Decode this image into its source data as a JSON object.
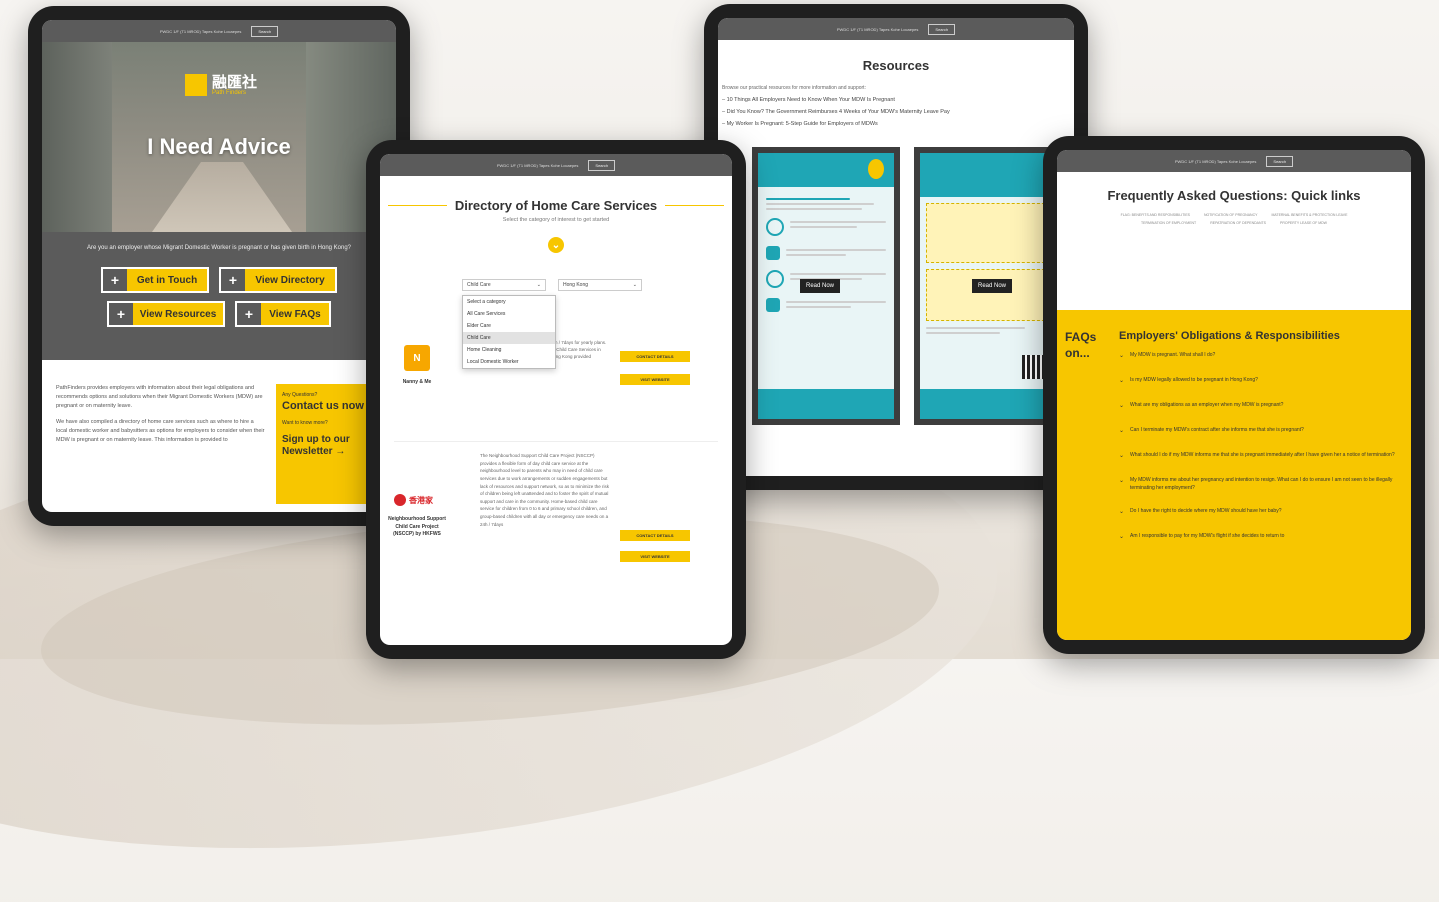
{
  "topbar": {
    "text": "PWDC 1/F (T1 MROD) Tapes Kohe Locaepes",
    "button": "Search"
  },
  "advice": {
    "logo_text": "融匯社",
    "logo_sub": "Path Finders",
    "hero_title": "I Need Advice",
    "question": "Are you an employer whose Migrant Domestic Worker is pregnant or has given birth in Hong Kong?",
    "buttons": [
      "Get in Touch",
      "View Directory",
      "View Resources",
      "View FAQs"
    ],
    "body_paragraphs": [
      "PathFinders provides employers with information about their legal obligations and recommends options and solutions when their Migrant Domestic Workers (MDW) are pregnant or on maternity leave.",
      "We have also compiled a directory of home care services such as where to hire a local domestic worker and babysitters as options for employers to consider when their MDW is pregnant or on maternity leave. This information is provided to"
    ],
    "side_box": {
      "small1": "Any Questions?",
      "contact": "Contact us now",
      "small2": "Want to know more?",
      "newsletter": "Sign up to our Newsletter →"
    }
  },
  "directory": {
    "title": "Directory of Home Care Services",
    "subtitle": "Select the category of interest to get started",
    "select_category": "Child Care",
    "select_region": "Hong Kong",
    "dropdown_options": [
      "Select a category",
      "All Care Services",
      "Elder Care",
      "Child Care",
      "Home Cleaning",
      "Local Domestic Worker"
    ],
    "provider1": {
      "name": "Nanny & Me",
      "desc": "24h / 7days for yearly plans. All Child Care Services in Hong Kong provided"
    },
    "provider2": {
      "logo_text": "香港家",
      "name": "Neighbourhood Support Child Care Project (NSCCP) by HKFWS",
      "desc": "The Neighbourhood Support Child Care Project (NSCCP) provides a flexible form of day child care service at the neighbourhood level to parents who may in need of child care services due to work arrangements or sudden engagements but lack of resources and support network, so as to minimize the risk of children being left unattended and to foster the spirit of mutual support and care in the community. Home-based child care service for children from 0 to 6 and primary school children, and group-based children with all day or emergency care needs on a 24h / 7days"
    },
    "contact_label": "CONTACT DETAILS",
    "website_label": "VISIT WEBSITE"
  },
  "resources": {
    "title": "Resources",
    "intro": "Browse our practical resources for more information and support:",
    "links": [
      "10 Things All Employers Need to Know When Your MDW Is Pregnant",
      "Did You Know? The Government Reimburses 4 Weeks of Your MDW's Maternity Leave Pay",
      "My Worker Is Pregnant: 5-Step Guide for Employers of MDWs"
    ],
    "read_now": "Read Now"
  },
  "faq": {
    "title": "Frequently Asked Questions: Quick links",
    "quick_links": [
      "FLAG: BENEFITS AND RESPONSIBILITIES",
      "NOTIFICATION OF PREGNANCY",
      "MATERNAL BENEFITS & PROTECTION LEAVE",
      "TERMINATION OF EMPLOYMENT",
      "REPATRIATION OF DEPENDANTS",
      "PROPERTY LEASE OF MDW"
    ],
    "faqs_label": "FAQs on...",
    "section_title": "Employers' Obligations & Responsibilities",
    "questions": [
      "My MDW is pregnant. What shall I do?",
      "Is my MDW legally allowed to be pregnant in Hong Kong?",
      "What are my obligations as an employer when my MDW is pregnant?",
      "Can I terminate my MDW's contract after she informs me that she is pregnant?",
      "What should I do if my MDW informs me that she is pregnant immediately after I have given her a notice of termination?",
      "My MDW informs me about her pregnancy and intention to resign. What can I do to ensure I am not seen to be illegally terminating her employment?",
      "Do I have the right to decide where my MDW should have her baby?",
      "Am I responsible to pay for my MDW's flight if she decides to return to"
    ]
  },
  "colors": {
    "accent": "#f7c600",
    "dark_gray": "#5b5b5b",
    "teal": "#1fa6b5"
  }
}
